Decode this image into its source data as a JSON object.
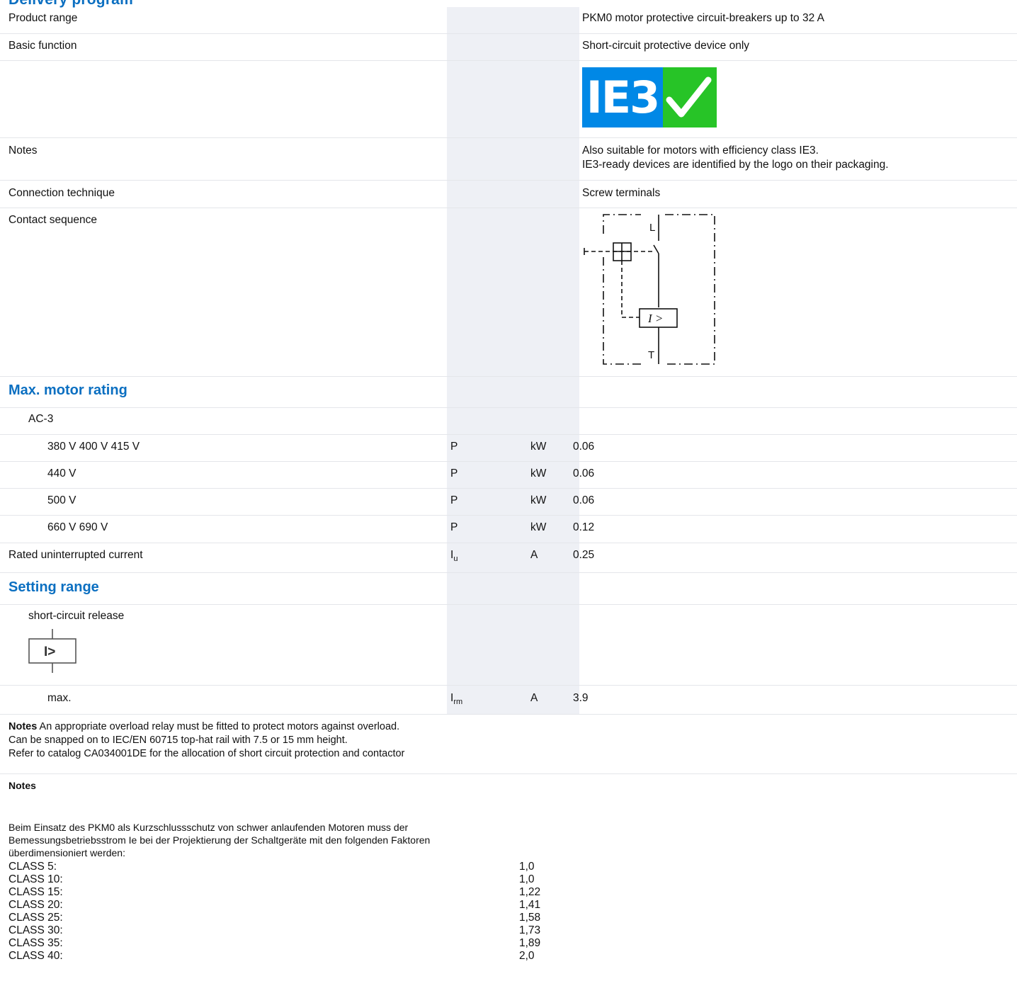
{
  "colors": {
    "accent": "#0b6fc1",
    "shade": "#eef0f5",
    "ie3_blue": "#0088e6",
    "ie3_green": "#27c427"
  },
  "header": {
    "title_fragment": "Delivery program"
  },
  "rows": {
    "product_range": {
      "label": "Product range",
      "value": "PKM0 motor protective circuit-breakers up to 32 A"
    },
    "basic_function": {
      "label": "Basic function",
      "value": "Short-circuit protective device only"
    },
    "ie3_logo": {
      "text": "IE3",
      "icon": "checkmark-icon"
    },
    "notes": {
      "label": "Notes",
      "line1": "Also suitable for motors with efficiency class IE3.",
      "line2": "IE3-ready devices are identified by the logo on their packaging."
    },
    "connection": {
      "label": "Connection technique",
      "value": "Screw terminals"
    },
    "contact_sequence": {
      "label": "Contact sequence",
      "diagram": {
        "top_label": "L",
        "bottom_label": "T",
        "box_label": "I >"
      }
    }
  },
  "motor_rating": {
    "title": "Max. motor rating",
    "subheading": "AC-3",
    "items": [
      {
        "label": "380 V 400 V 415 V",
        "symbol": "P",
        "unit": "kW",
        "value": "0.06"
      },
      {
        "label": "440 V",
        "symbol": "P",
        "unit": "kW",
        "value": "0.06"
      },
      {
        "label": "500 V",
        "symbol": "P",
        "unit": "kW",
        "value": "0.06"
      },
      {
        "label": "660 V 690 V",
        "symbol": "P",
        "unit": "kW",
        "value": "0.12"
      }
    ],
    "uninterrupted": {
      "label": "Rated uninterrupted current",
      "symbol": "I",
      "symbol_sub": "u",
      "unit": "A",
      "value": "0.25"
    }
  },
  "setting_range": {
    "title": "Setting range",
    "release_label": "short-circuit release",
    "release_icon_text": "I>",
    "max": {
      "label": "max.",
      "symbol": "I",
      "symbol_sub": "rm",
      "unit": "A",
      "value": "3.9"
    }
  },
  "notes_en": {
    "bold": "Notes",
    "line1": "An appropriate overload relay must be fitted to protect motors against overload.",
    "line2": "Can be snapped on to IEC/EN 60715 top-hat rail with 7.5 or 15 mm height.",
    "line3": "Refer to catalog CA034001DE for the allocation of short circuit protection and contactor"
  },
  "notes_de": {
    "title": "Notes",
    "line1": "Beim Einsatz des PKM0 als Kurzschlussschutz von schwer anlaufenden Motoren muss der",
    "line2": "Bemessungsbetriebsstrom Ie bei der Projektierung der Schaltgeräte mit den folgenden Faktoren",
    "line3": "überdimensioniert werden:",
    "classes": [
      {
        "name": "CLASS 5:",
        "factor": "1,0"
      },
      {
        "name": "CLASS 10:",
        "factor": "1,0"
      },
      {
        "name": "CLASS 15:",
        "factor": "1,22"
      },
      {
        "name": "CLASS 20:",
        "factor": "1,41"
      },
      {
        "name": "CLASS 25:",
        "factor": "1,58"
      },
      {
        "name": "CLASS 30:",
        "factor": "1,73"
      },
      {
        "name": "CLASS 35:",
        "factor": "1,89"
      },
      {
        "name": "CLASS 40:",
        "factor": "2,0"
      }
    ]
  }
}
